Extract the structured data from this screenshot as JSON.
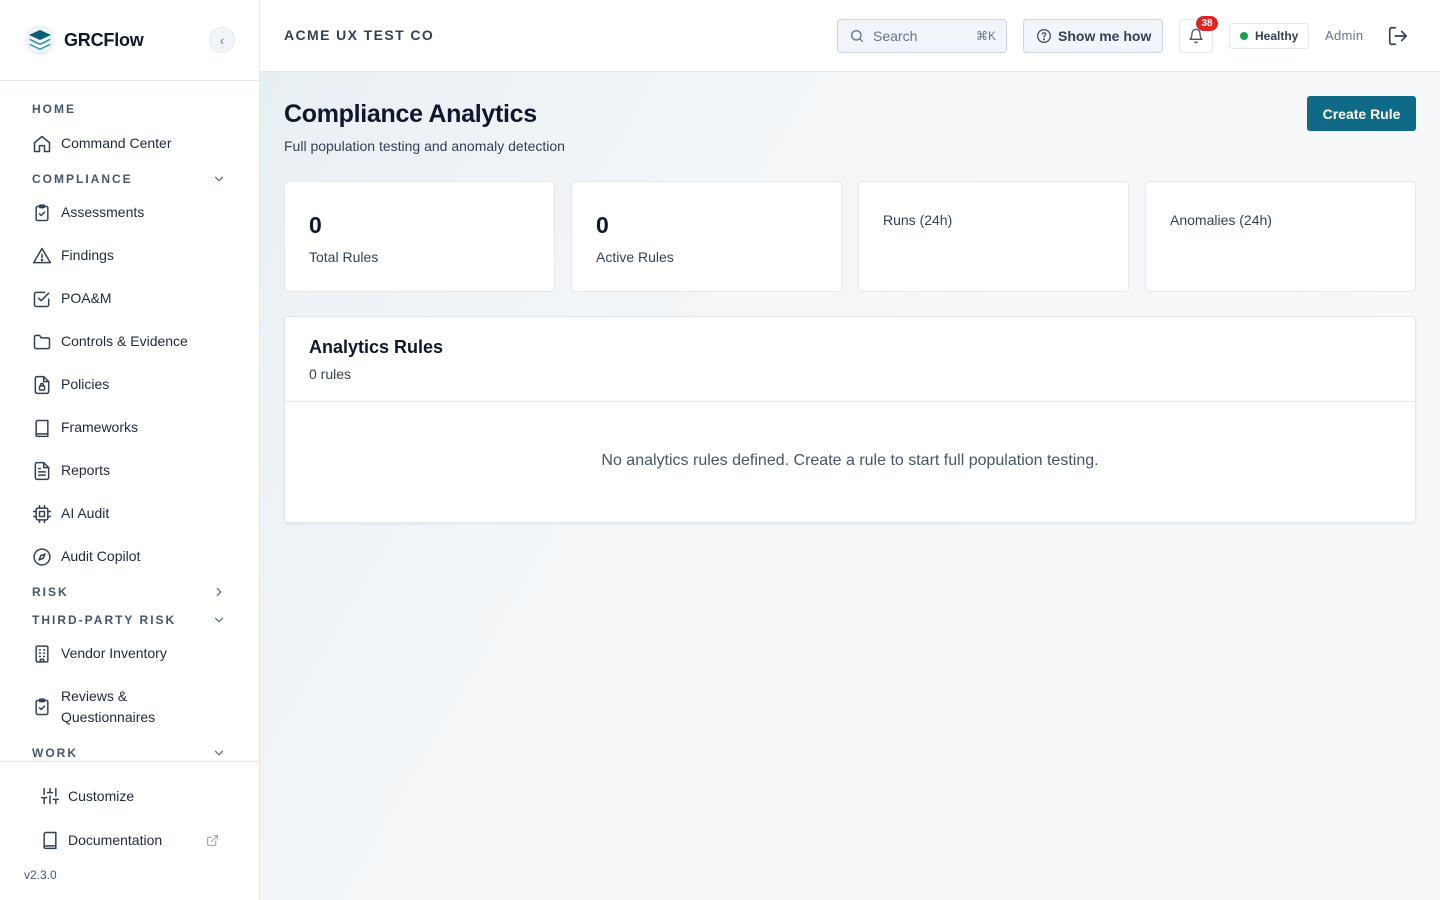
{
  "brand": {
    "name": "GRCFlow",
    "collapse_glyph": "‹"
  },
  "sidebar": {
    "sections": {
      "home": "HOME",
      "compliance": "COMPLIANCE",
      "risk": "RISK",
      "third_party": "THIRD-PARTY RISK",
      "work": "WORK"
    },
    "items": {
      "command_center": "Command Center",
      "assessments": "Assessments",
      "findings": "Findings",
      "poam": "POA&M",
      "controls": "Controls & Evidence",
      "policies": "Policies",
      "frameworks": "Frameworks",
      "reports": "Reports",
      "ai_audit": "AI Audit",
      "audit_copilot": "Audit Copilot",
      "vendor_inventory": "Vendor Inventory",
      "reviews_line1": "Reviews &",
      "reviews_line2": "Questionnaires"
    },
    "footer": {
      "customize": "Customize",
      "documentation": "Documentation",
      "version": "v2.3.0"
    }
  },
  "header": {
    "org": "ACME UX TEST CO",
    "search_placeholder": "Search",
    "search_shortcut": "⌘K",
    "help": "Show me how",
    "notifications": "38",
    "health": "Healthy",
    "health_color": "#16a34a",
    "user": "Admin"
  },
  "page": {
    "title": "Compliance Analytics",
    "subtitle": "Full population testing and anomaly detection",
    "create_button": "Create Rule",
    "accent": "#0e6a86"
  },
  "stats": {
    "total_rules": {
      "value": "0",
      "label": "Total Rules"
    },
    "active_rules": {
      "value": "0",
      "label": "Active Rules"
    },
    "runs": {
      "label": "Runs (24h)"
    },
    "anomalies": {
      "label": "Anomalies (24h)"
    }
  },
  "rules_panel": {
    "title": "Analytics Rules",
    "count": "0 rules",
    "empty": "No analytics rules defined. Create a rule to start full population testing."
  }
}
